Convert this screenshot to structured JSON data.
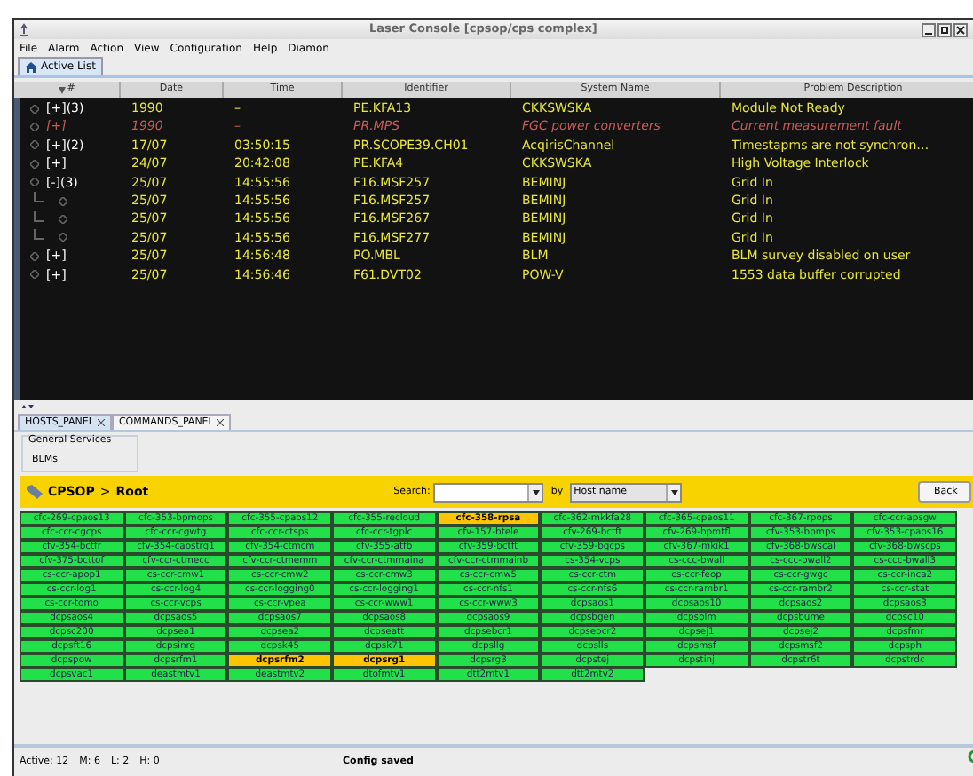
{
  "window": {
    "title": "Laser Console  [cpsop/cps complex]"
  },
  "menu": [
    "File",
    "Alarm",
    "Action",
    "View",
    "Configuration",
    "Help",
    "Diamon"
  ],
  "tabs": [
    {
      "label": "Active List",
      "selected": true
    }
  ],
  "table": {
    "columns": [
      "#",
      "Date",
      "Time",
      "Identifier",
      "System Name",
      "Problem Description"
    ],
    "rows": [
      {
        "prefix": "[+](3)",
        "masked": false,
        "date": "1990",
        "time": "–",
        "identifier": "PE.KFA13",
        "system": "CKKSWSKA",
        "problem": "Module Not Ready"
      },
      {
        "prefix": "[+]",
        "masked": true,
        "date": "1990",
        "time": "–",
        "identifier": "PR.MPS",
        "system": "FGC power converters",
        "problem": "Current measurement fault"
      },
      {
        "prefix": "[+](2)",
        "masked": false,
        "date": "17/07",
        "time": "03:50:15",
        "identifier": "PR.SCOPE39.CH01",
        "system": "AcqirisChannel",
        "problem": "Timestapms are not synchron…"
      },
      {
        "prefix": "[+]",
        "masked": false,
        "date": "24/07",
        "time": "20:42:08",
        "identifier": "PE.KFA4",
        "system": "CKKSWSKA",
        "problem": "High Voltage Interlock"
      },
      {
        "prefix": "[-](3)",
        "masked": false,
        "date": "25/07",
        "time": "14:55:56",
        "identifier": "F16.MSF257",
        "system": "BEMINJ",
        "problem": "Grid In",
        "children": [
          {
            "date": "25/07",
            "time": "14:55:56",
            "identifier": "F16.MSF257",
            "system": "BEMINJ",
            "problem": "Grid In"
          },
          {
            "date": "25/07",
            "time": "14:55:56",
            "identifier": "F16.MSF267",
            "system": "BEMINJ",
            "problem": "Grid In"
          },
          {
            "date": "25/07",
            "time": "14:55:56",
            "identifier": "F16.MSF277",
            "system": "BEMINJ",
            "problem": "Grid In"
          }
        ]
      },
      {
        "prefix": "[+]",
        "masked": false,
        "date": "25/07",
        "time": "14:56:48",
        "identifier": "PO.MBL",
        "system": "BLM",
        "problem": "BLM survey disabled on user"
      },
      {
        "prefix": "[+]",
        "masked": false,
        "date": "25/07",
        "time": "14:56:46",
        "identifier": "F61.DVT02",
        "system": "POW-V",
        "problem": "1553 data buffer corrupted"
      }
    ]
  },
  "panel_tabs": [
    {
      "label": "HOSTS_PANEL",
      "selected": true
    },
    {
      "label": "COMMANDS_PANEL",
      "selected": false
    }
  ],
  "services": {
    "title": "General Services",
    "items": [
      "BLMs"
    ]
  },
  "breadcrumb": {
    "root": "CPSOP",
    "separator": ">",
    "current": "Root"
  },
  "search": {
    "label": "Search:",
    "by_label": "by",
    "by_value": "Host name",
    "button": "Back"
  },
  "hosts": [
    {
      "name": "cfc-269-cpaos13",
      "alarm": false
    },
    {
      "name": "cfc-353-bpmops",
      "alarm": false
    },
    {
      "name": "cfc-355-cpaos12",
      "alarm": false
    },
    {
      "name": "cfc-355-recloud",
      "alarm": false
    },
    {
      "name": "cfc-358-rpsa",
      "alarm": true
    },
    {
      "name": "cfc-362-mkkfa28",
      "alarm": false
    },
    {
      "name": "cfc-365-cpaos11",
      "alarm": false
    },
    {
      "name": "cfc-367-rpops",
      "alarm": false
    },
    {
      "name": "cfc-ccr-apsgw",
      "alarm": false
    },
    {
      "name": "cfc-ccr-cgcps",
      "alarm": false
    },
    {
      "name": "cfc-ccr-cgwtg",
      "alarm": false
    },
    {
      "name": "cfc-ccr-ctsps",
      "alarm": false
    },
    {
      "name": "cfc-ccr-tgplc",
      "alarm": false
    },
    {
      "name": "cfv-157-btele",
      "alarm": false
    },
    {
      "name": "cfv-269-bctft",
      "alarm": false
    },
    {
      "name": "cfv-269-bpmtfl",
      "alarm": false
    },
    {
      "name": "cfv-353-bpmps",
      "alarm": false
    },
    {
      "name": "cfv-353-cpaos16",
      "alarm": false
    },
    {
      "name": "cfv-354-bctfr",
      "alarm": false
    },
    {
      "name": "cfv-354-caostrg1",
      "alarm": false
    },
    {
      "name": "cfv-354-ctmcm",
      "alarm": false
    },
    {
      "name": "cfv-355-atfb",
      "alarm": false
    },
    {
      "name": "cfv-359-bctft",
      "alarm": false
    },
    {
      "name": "cfv-359-bqcps",
      "alarm": false
    },
    {
      "name": "cfv-367-mkik1",
      "alarm": false
    },
    {
      "name": "cfv-368-bwscal",
      "alarm": false
    },
    {
      "name": "cfv-368-bwscps",
      "alarm": false
    },
    {
      "name": "cfv-375-bcttof",
      "alarm": false
    },
    {
      "name": "cfv-ccr-ctmecc",
      "alarm": false
    },
    {
      "name": "cfv-ccr-ctmemm",
      "alarm": false
    },
    {
      "name": "cfv-ccr-ctmmaina",
      "alarm": false
    },
    {
      "name": "cfv-ccr-ctmmainb",
      "alarm": false
    },
    {
      "name": "cs-354-vcps",
      "alarm": false
    },
    {
      "name": "cs-ccc-bwall",
      "alarm": false
    },
    {
      "name": "cs-ccc-bwall2",
      "alarm": false
    },
    {
      "name": "cs-ccc-bwall3",
      "alarm": false
    },
    {
      "name": "cs-ccr-apop1",
      "alarm": false
    },
    {
      "name": "cs-ccr-cmw1",
      "alarm": false
    },
    {
      "name": "cs-ccr-cmw2",
      "alarm": false
    },
    {
      "name": "cs-ccr-cmw3",
      "alarm": false
    },
    {
      "name": "cs-ccr-cmw5",
      "alarm": false
    },
    {
      "name": "cs-ccr-ctm",
      "alarm": false
    },
    {
      "name": "cs-ccr-feop",
      "alarm": false
    },
    {
      "name": "cs-ccr-gwgc",
      "alarm": false
    },
    {
      "name": "cs-ccr-inca2",
      "alarm": false
    },
    {
      "name": "cs-ccr-log1",
      "alarm": false
    },
    {
      "name": "cs-ccr-log4",
      "alarm": false
    },
    {
      "name": "cs-ccr-logging0",
      "alarm": false
    },
    {
      "name": "cs-ccr-logging1",
      "alarm": false
    },
    {
      "name": "cs-ccr-nfs1",
      "alarm": false
    },
    {
      "name": "cs-ccr-nfs6",
      "alarm": false
    },
    {
      "name": "cs-ccr-rambr1",
      "alarm": false
    },
    {
      "name": "cs-ccr-rambr2",
      "alarm": false
    },
    {
      "name": "cs-ccr-stat",
      "alarm": false
    },
    {
      "name": "cs-ccr-tomo",
      "alarm": false
    },
    {
      "name": "cs-ccr-vcps",
      "alarm": false
    },
    {
      "name": "cs-ccr-vpea",
      "alarm": false
    },
    {
      "name": "cs-ccr-www1",
      "alarm": false
    },
    {
      "name": "cs-ccr-www3",
      "alarm": false
    },
    {
      "name": "dcpsaos1",
      "alarm": false
    },
    {
      "name": "dcpsaos10",
      "alarm": false
    },
    {
      "name": "dcpsaos2",
      "alarm": false
    },
    {
      "name": "dcpsaos3",
      "alarm": false
    },
    {
      "name": "dcpsaos4",
      "alarm": false
    },
    {
      "name": "dcpsaos5",
      "alarm": false
    },
    {
      "name": "dcpsaos7",
      "alarm": false
    },
    {
      "name": "dcpsaos8",
      "alarm": false
    },
    {
      "name": "dcpsaos9",
      "alarm": false
    },
    {
      "name": "dcpsbgen",
      "alarm": false
    },
    {
      "name": "dcpsblm",
      "alarm": false
    },
    {
      "name": "dcpsbume",
      "alarm": false
    },
    {
      "name": "dcpsc10",
      "alarm": false
    },
    {
      "name": "dcpsc200",
      "alarm": false
    },
    {
      "name": "dcpsea1",
      "alarm": false
    },
    {
      "name": "dcpsea2",
      "alarm": false
    },
    {
      "name": "dcpseatt",
      "alarm": false
    },
    {
      "name": "dcpsebcr1",
      "alarm": false
    },
    {
      "name": "dcpsebcr2",
      "alarm": false
    },
    {
      "name": "dcpsej1",
      "alarm": false
    },
    {
      "name": "dcpsej2",
      "alarm": false
    },
    {
      "name": "dcpsfmr",
      "alarm": false
    },
    {
      "name": "dcpsft16",
      "alarm": false
    },
    {
      "name": "dcpsinrg",
      "alarm": false
    },
    {
      "name": "dcpsk45",
      "alarm": false
    },
    {
      "name": "dcpsk71",
      "alarm": false
    },
    {
      "name": "dcpsllg",
      "alarm": false
    },
    {
      "name": "dcpslls",
      "alarm": false
    },
    {
      "name": "dcpsmsf",
      "alarm": false
    },
    {
      "name": "dcpsmsf2",
      "alarm": false
    },
    {
      "name": "dcpsph",
      "alarm": false
    },
    {
      "name": "dcpspow",
      "alarm": false
    },
    {
      "name": "dcpsrfm1",
      "alarm": false
    },
    {
      "name": "dcpsrfm2",
      "alarm": true
    },
    {
      "name": "dcpsrg1",
      "alarm": true
    },
    {
      "name": "dcpsrg3",
      "alarm": false
    },
    {
      "name": "dcpstej",
      "alarm": false
    },
    {
      "name": "dcpstinj",
      "alarm": false
    },
    {
      "name": "dcpstr6t",
      "alarm": false
    },
    {
      "name": "dcpstrdc",
      "alarm": false
    },
    {
      "name": "dcpsvac1",
      "alarm": false
    },
    {
      "name": "deastmtv1",
      "alarm": false
    },
    {
      "name": "deastmtv2",
      "alarm": false
    },
    {
      "name": "dtofmtv1",
      "alarm": false
    },
    {
      "name": "dtt2mtv1",
      "alarm": false
    },
    {
      "name": "dtt2mtv2",
      "alarm": false
    }
  ],
  "status_bar": {
    "counts": [
      "Active: 12",
      "M: 6",
      "L: 2",
      "H: 0"
    ],
    "message": "Config saved"
  }
}
